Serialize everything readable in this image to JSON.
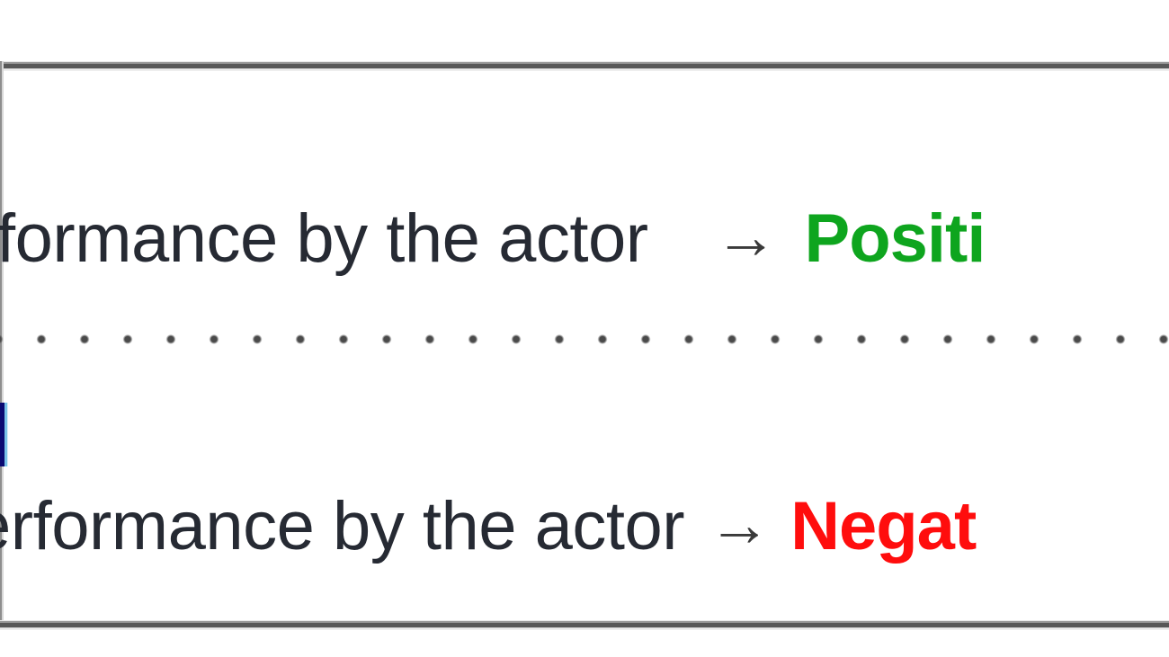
{
  "document": {
    "type": "sentiment-classification-examples",
    "background_color": "#ffffff"
  },
  "rules": {
    "top_label": "table-top-rule",
    "bottom_label": "table-bottom-rule",
    "left_label": "table-left-rule",
    "color": "#585858"
  },
  "separator": {
    "style": "dotted",
    "color": "#4a4a4a"
  },
  "fragments": {
    "blue_clipped_word": {
      "color": "#0a0a72",
      "note": "clipped-left-edge-glyph"
    }
  },
  "examples": [
    {
      "id": "example-positive",
      "sentence": "formance by the actor",
      "arrow": "→",
      "label": "Positi",
      "label_sentiment": "positive",
      "label_color": "#0ea51e"
    },
    {
      "id": "example-negative",
      "sentence": "erformance by the actor",
      "arrow": "→",
      "label": "Negat",
      "label_sentiment": "negative",
      "label_color": "#ff0d0d"
    }
  ]
}
